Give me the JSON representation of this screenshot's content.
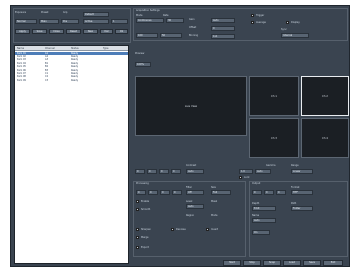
{
  "top_bar": {
    "labels": [
      "Exposure",
      "Preset",
      "Grp"
    ],
    "fields": [
      "Default",
      "Normal",
      "Main",
      "Pos",
      "Active",
      "1"
    ],
    "buttons": [
      "Apply",
      "Save",
      "Close",
      "Reset",
      "New",
      "Del",
      "Ok"
    ]
  },
  "list": {
    "columns": [
      "Name",
      "Channel",
      "Status",
      "Type"
    ],
    "rows": [
      {
        "name": "Item 01",
        "ch": "A1",
        "status": "Ready",
        "sel": true
      },
      {
        "name": "Item 02",
        "ch": "A2",
        "status": "Ready",
        "sel": false
      },
      {
        "name": "Item 03",
        "ch": "A3",
        "status": "Ready",
        "sel": false
      },
      {
        "name": "Item 04",
        "ch": "B1",
        "status": "Ready",
        "sel": false
      },
      {
        "name": "Item 05",
        "ch": "B2",
        "status": "Ready",
        "sel": false
      },
      {
        "name": "Item 06",
        "ch": "B3",
        "status": "Ready",
        "sel": false
      },
      {
        "name": "Item 07",
        "ch": "C1",
        "status": "Ready",
        "sel": false
      },
      {
        "name": "Item 08",
        "ch": "C2",
        "status": "Ready",
        "sel": false
      },
      {
        "name": "Item 09",
        "ch": "C3",
        "status": "Ready",
        "sel": false
      }
    ]
  },
  "settings": {
    "title": "Acquisition Settings",
    "labels": [
      "Mode",
      "Rate",
      "Gain",
      "Offset",
      "Binning",
      "Sync"
    ],
    "fields": [
      "Continuous",
      "30",
      "Auto",
      "0",
      "1x1",
      "Internal",
      "100",
      "50"
    ],
    "options": [
      "Trigger",
      "Average",
      "Display"
    ]
  },
  "preview": {
    "title": "Preview",
    "zoom": "100%",
    "main_label": "Live View",
    "quads": [
      "Ch 1",
      "Ch 2",
      "Ch 3",
      "Ch 4"
    ]
  },
  "mid_controls": {
    "fields": [
      "0",
      "0",
      "0",
      "0",
      "Auto",
      "1.0",
      "Auto",
      "Linear"
    ],
    "labels": [
      "Contrast",
      "Gamma",
      "Range"
    ],
    "option": "Lock"
  },
  "bottom_left": {
    "title": "Processing",
    "fields": [
      "0",
      "0",
      "0",
      "0",
      "Off",
      "Full",
      "Auto"
    ],
    "labels": [
      "Filter",
      "Size",
      "Level",
      "Mask",
      "Region",
      "Mode"
    ],
    "options": [
      "Enable",
      "Smooth",
      "Sharpen",
      "Denoise",
      "Invert",
      "Merge",
      "Export"
    ]
  },
  "bottom_right": {
    "title": "Output",
    "fields": [
      "0",
      "0",
      "0",
      "TIFF",
      "8 bit",
      "Folder",
      "Auto",
      "On"
    ],
    "labels": [
      "Format",
      "Depth",
      "Path",
      "Name"
    ]
  },
  "footer_buttons": [
    "Start",
    "Stop",
    "Snap",
    "Load",
    "Save",
    "Exit"
  ]
}
